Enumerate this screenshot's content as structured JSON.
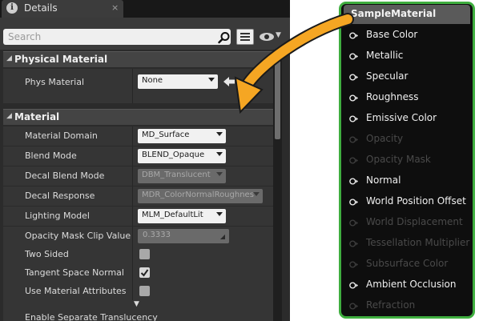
{
  "details": {
    "tab_title": "Details",
    "tab_close": "×",
    "search_placeholder": "Search",
    "categories": {
      "physical": "Physical Material",
      "material": "Material"
    },
    "phys_material": {
      "label": "Phys Material",
      "value": "None"
    },
    "rows": [
      {
        "label": "Material Domain",
        "value": "MD_Surface"
      },
      {
        "label": "Blend Mode",
        "value": "BLEND_Opaque"
      },
      {
        "label": "Decal Blend Mode",
        "value": "DBM_Translucent"
      },
      {
        "label": "Decal Response",
        "value": "MDR_ColorNormalRoughness"
      },
      {
        "label": "Lighting Model",
        "value": "MLM_DefaultLit"
      },
      {
        "label": "Opacity Mask Clip Value",
        "value": "0.3333"
      },
      {
        "label": "Two Sided",
        "checked": false
      },
      {
        "label": "Tangent Space Normal",
        "checked": true
      },
      {
        "label": "Use Material Attributes",
        "checked": false
      }
    ],
    "cut_off_row_label": "Enable Separate Translucency",
    "accent_colors": {
      "panel": "#2b2b2b",
      "field": "#f1f1f1"
    }
  },
  "node": {
    "title": "SampleMaterial",
    "border_color": "#3fae3f",
    "pins": [
      {
        "label": "Base Color",
        "active": true
      },
      {
        "label": "Metallic",
        "active": true
      },
      {
        "label": "Specular",
        "active": true
      },
      {
        "label": "Roughness",
        "active": true
      },
      {
        "label": "Emissive Color",
        "active": true
      },
      {
        "label": "Opacity",
        "active": false
      },
      {
        "label": "Opacity Mask",
        "active": false
      },
      {
        "label": "Normal",
        "active": true
      },
      {
        "label": "World Position Offset",
        "active": true
      },
      {
        "label": "World Displacement",
        "active": false
      },
      {
        "label": "Tessellation Multiplier",
        "active": false
      },
      {
        "label": "Subsurface Color",
        "active": false
      },
      {
        "label": "Ambient Occlusion",
        "active": true
      },
      {
        "label": "Refraction",
        "active": false
      }
    ]
  },
  "arrow_color": "#f5a623"
}
